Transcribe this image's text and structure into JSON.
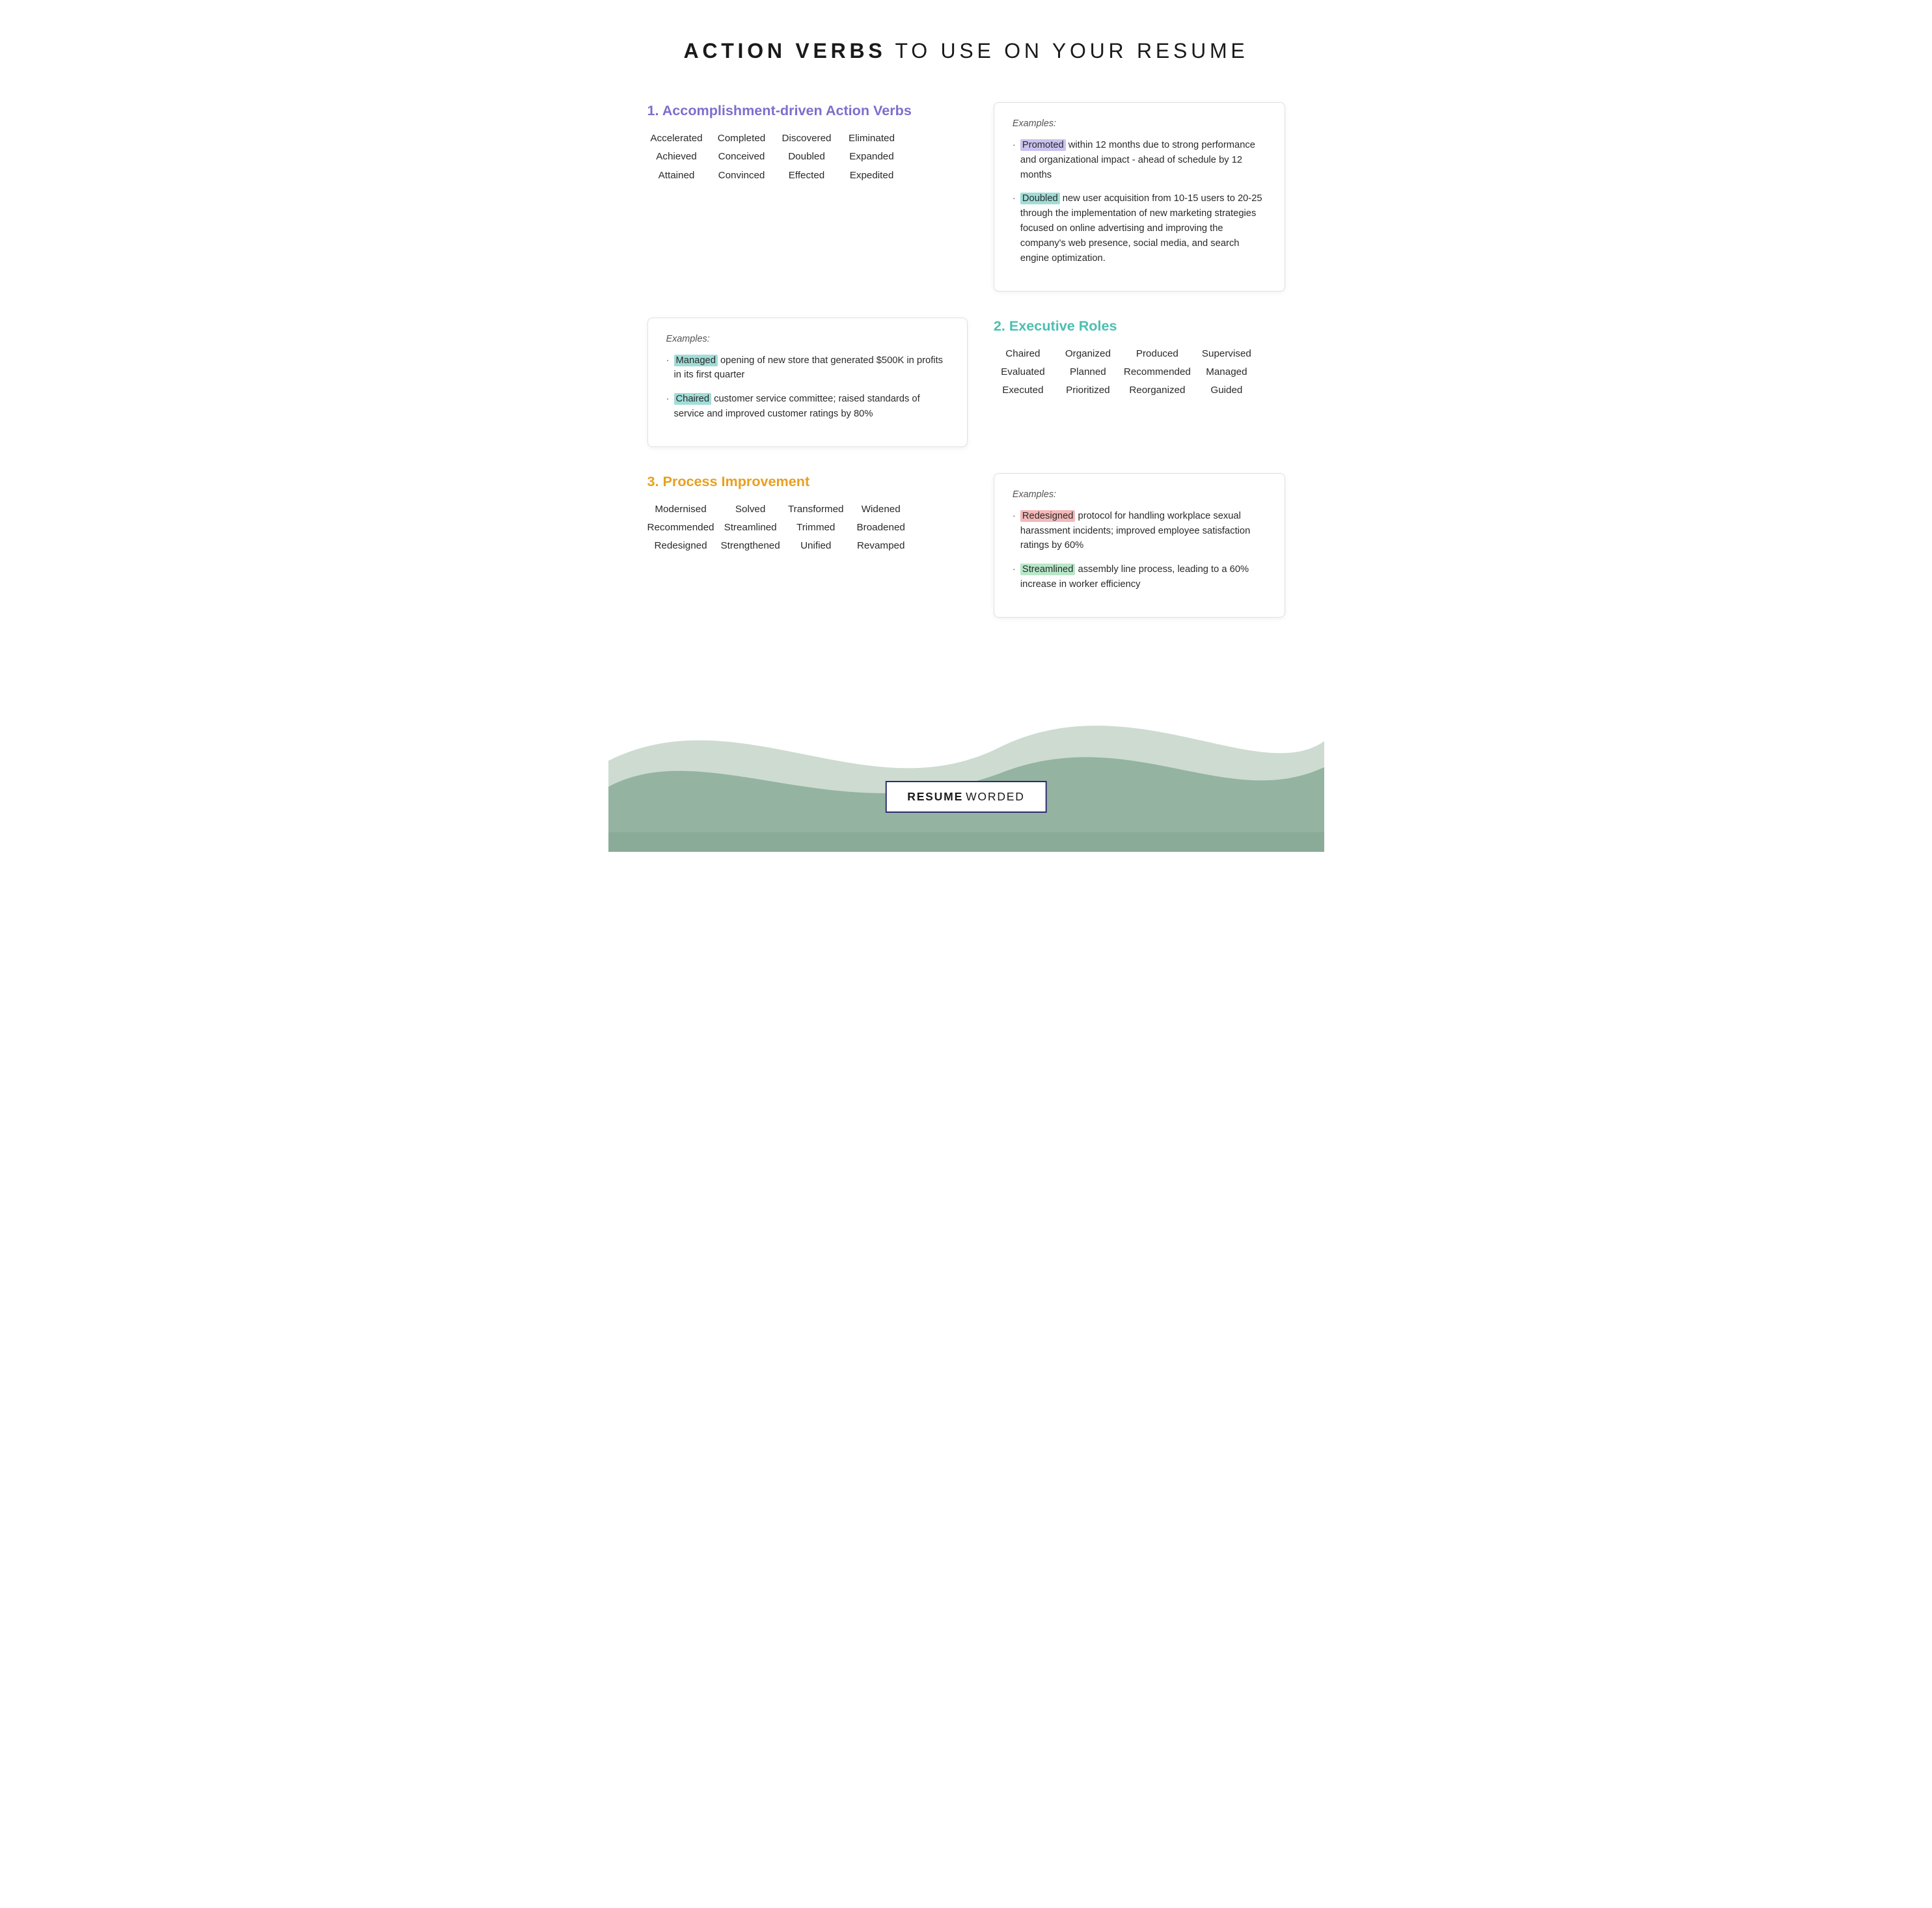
{
  "header": {
    "title_bold": "ACTION VERBS",
    "title_light": " TO USE ON YOUR RESUME"
  },
  "section1": {
    "heading": "1. Accomplishment-driven Action Verbs",
    "words": [
      [
        "Accelerated",
        "Achieved",
        "Attained"
      ],
      [
        "Completed",
        "Conceived",
        "Convinced"
      ],
      [
        "Discovered",
        "Doubled",
        "Effected"
      ],
      [
        "Eliminated",
        "Expanded",
        "Expedited"
      ]
    ],
    "examples_label": "Examples:",
    "examples": [
      {
        "highlight": "Promoted",
        "highlight_class": "highlight-purple",
        "text": " within 12 months due to strong performance and organizational impact - ahead of schedule by 12 months"
      },
      {
        "highlight": "Doubled",
        "highlight_class": "highlight-teal",
        "text": " new user acquisition from 10-15 users to 20-25 through the implementation of new marketing strategies focused on online advertising and improving the company's web presence, social media, and search engine optimization."
      }
    ]
  },
  "section2_left_examples": {
    "examples_label": "Examples:",
    "examples": [
      {
        "highlight": "Managed",
        "highlight_class": "highlight-teal",
        "text": " opening of new store that generated $500K in profits in its first quarter"
      },
      {
        "highlight": "Chaired",
        "highlight_class": "highlight-teal",
        "text": " customer service committee; raised standards of service and improved customer ratings by 80%"
      }
    ]
  },
  "section2": {
    "heading": "2. Executive Roles",
    "words": [
      [
        "Chaired",
        "Evaluated",
        "Executed"
      ],
      [
        "Organized",
        "Planned",
        "Prioritized"
      ],
      [
        "Produced",
        "Recommended",
        "Reorganized"
      ],
      [
        "Supervised",
        "Managed",
        "Guided"
      ]
    ]
  },
  "section3": {
    "heading": "3. Process Improvement",
    "words": [
      [
        "Modernised",
        "Recommended",
        "Redesigned"
      ],
      [
        "Solved",
        "Streamlined",
        "Strengthened"
      ],
      [
        "Transformed",
        "Trimmed",
        "Unified"
      ],
      [
        "Widened",
        "Broadened",
        "Revamped"
      ]
    ],
    "examples_label": "Examples:",
    "examples": [
      {
        "highlight": "Redesigned",
        "highlight_class": "highlight-pink",
        "text": " protocol for handling workplace sexual harassment incidents; improved employee satisfaction ratings by 60%"
      },
      {
        "highlight": "Streamlined",
        "highlight_class": "highlight-green",
        "text": " assembly line process, leading to a 60% increase in worker efficiency"
      }
    ]
  },
  "footer": {
    "brand_bold": "RESUME",
    "brand_light": "WORDED"
  },
  "colors": {
    "purple": "#7c6fcd",
    "teal": "#4cbfb0",
    "orange": "#e8a020",
    "highlight_purple": "#c9c2f0",
    "highlight_teal": "#a0ddd8",
    "highlight_pink": "#f4b8b8",
    "highlight_green": "#b8e8c8",
    "wave_dark": "#8aab98",
    "wave_light": "#b8ccbe"
  }
}
